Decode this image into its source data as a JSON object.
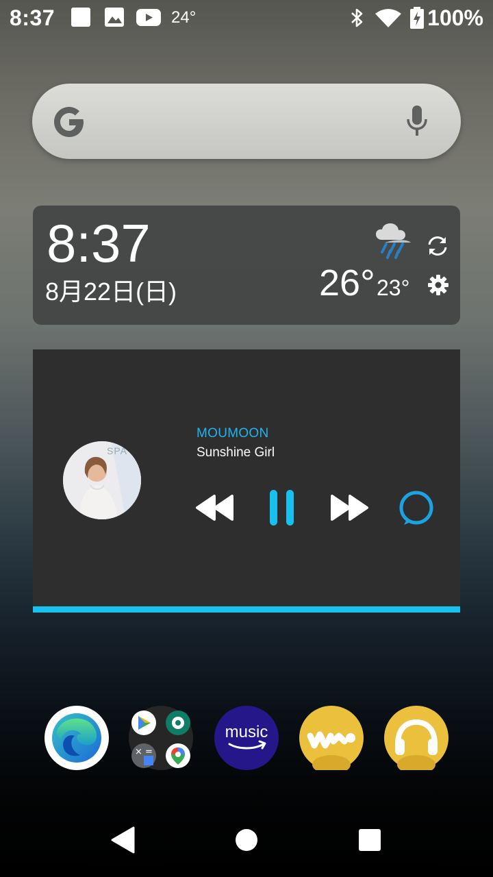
{
  "status_bar": {
    "time": "8:37",
    "temperature": "24°",
    "battery": "100%",
    "icons": [
      "square-notification-icon",
      "image-icon",
      "youtube-icon",
      "bluetooth-icon",
      "wifi-icon",
      "battery-charging-icon"
    ]
  },
  "search_bar": {
    "icons": [
      "google-g-icon",
      "microphone-icon"
    ]
  },
  "clock_widget": {
    "time": "8:37",
    "date": "8月22日(日)",
    "weather": {
      "condition_icon": "rain-cloud-icon",
      "temp_high": "26°",
      "temp_low": "23°"
    },
    "icons": [
      "refresh-icon",
      "settings-icon"
    ]
  },
  "music_widget": {
    "artist": "MOUMOON",
    "title": "Sunshine Girl",
    "album_art_text": "SPA",
    "progress_percent": 100,
    "accent": "#18c0f0",
    "controls": [
      "rewind-icon",
      "pause-icon",
      "fast-forward-icon",
      "alexa-icon"
    ]
  },
  "dock": {
    "apps": [
      {
        "name": "edge-icon"
      },
      {
        "name": "app-folder-icon"
      },
      {
        "name": "amazon-music-icon",
        "label": "music"
      },
      {
        "name": "walkman-icon"
      },
      {
        "name": "headphones-app-icon"
      }
    ]
  },
  "nav_bar": {
    "buttons": [
      "back-icon",
      "home-icon",
      "recents-icon"
    ]
  }
}
